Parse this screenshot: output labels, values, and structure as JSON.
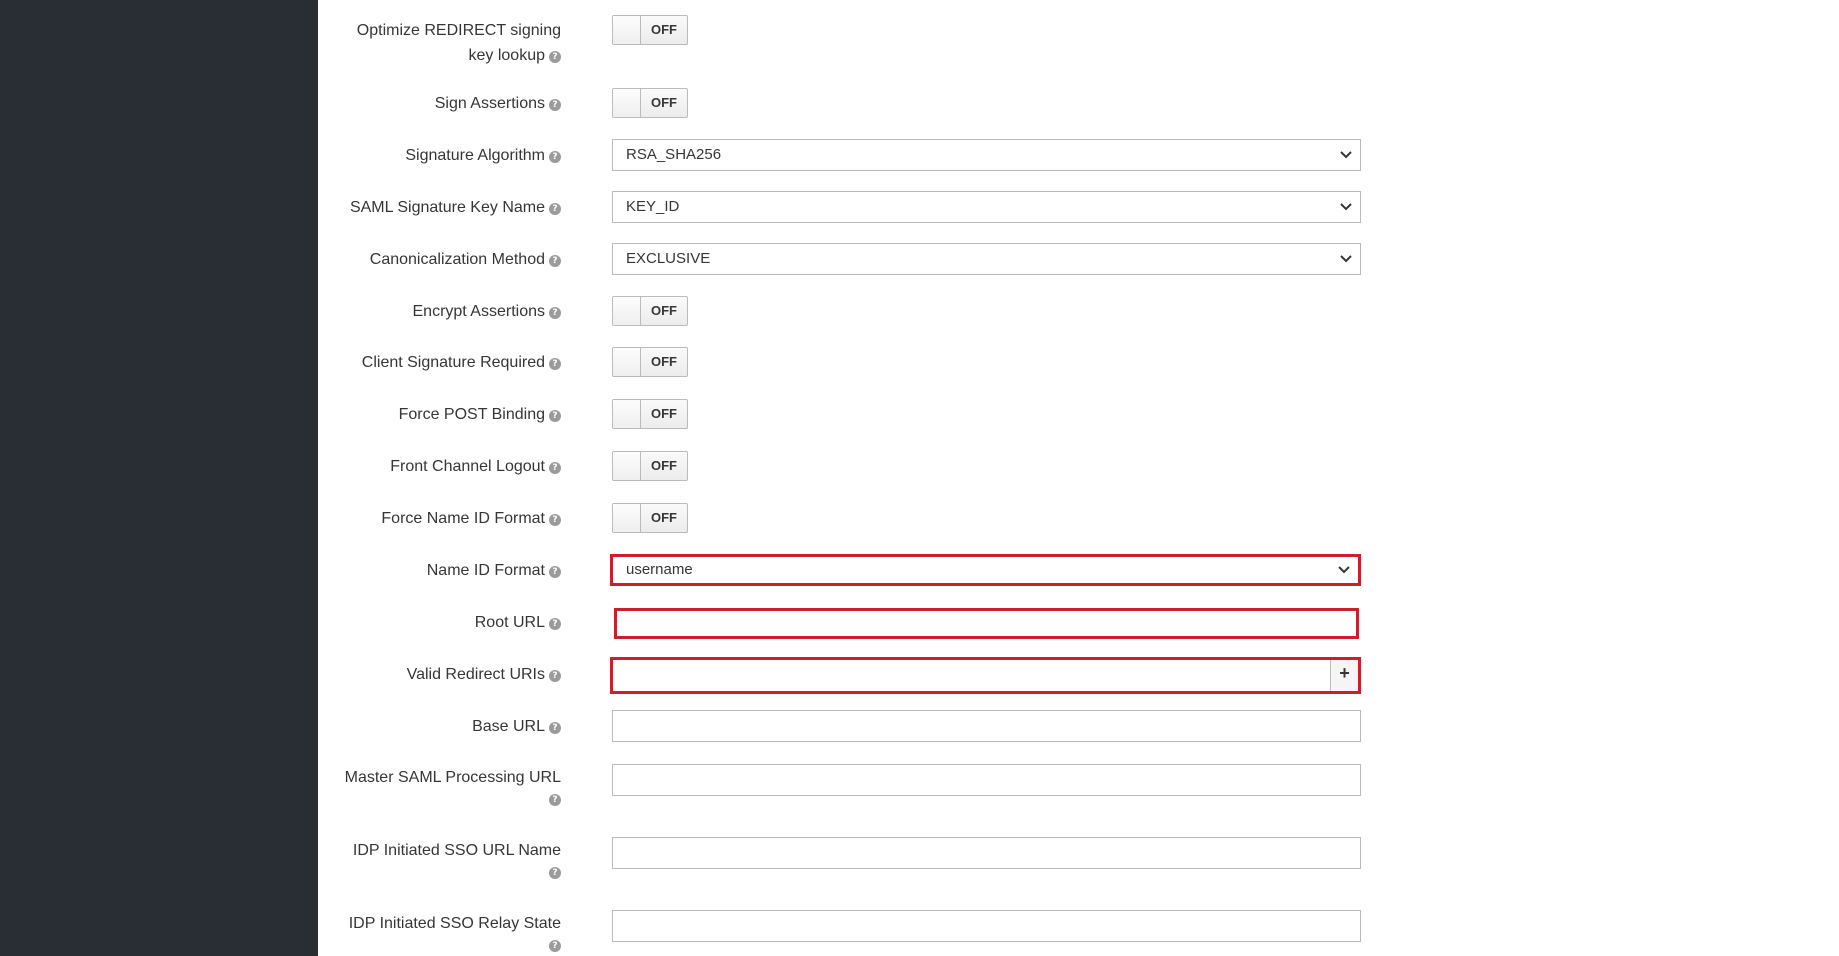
{
  "help_glyph": "?",
  "chevron": "chevron-down",
  "fields": {
    "optimize_redirect": {
      "label_line1": "Optimize REDIRECT signing",
      "label_line2": "key lookup",
      "state": "OFF"
    },
    "sign_assertions": {
      "label": "Sign Assertions",
      "state": "OFF"
    },
    "signature_algorithm": {
      "label": "Signature Algorithm",
      "value": "RSA_SHA256"
    },
    "saml_signature_key_name": {
      "label": "SAML Signature Key Name",
      "value": "KEY_ID"
    },
    "canonicalization_method": {
      "label": "Canonicalization Method",
      "value": "EXCLUSIVE"
    },
    "encrypt_assertions": {
      "label": "Encrypt Assertions",
      "state": "OFF"
    },
    "client_signature_required": {
      "label": "Client Signature Required",
      "state": "OFF"
    },
    "force_post_binding": {
      "label": "Force POST Binding",
      "state": "OFF"
    },
    "front_channel_logout": {
      "label": "Front Channel Logout",
      "state": "OFF"
    },
    "force_name_id_format": {
      "label": "Force Name ID Format",
      "state": "OFF"
    },
    "name_id_format": {
      "label": "Name ID Format",
      "value": "username",
      "highlighted": true
    },
    "root_url": {
      "label": "Root URL",
      "value": "",
      "highlighted": true
    },
    "valid_redirect_uris": {
      "label": "Valid Redirect URIs",
      "value": "",
      "add_label": "+",
      "highlighted": true
    },
    "base_url": {
      "label": "Base URL",
      "value": ""
    },
    "master_saml_processing_url": {
      "label": "Master SAML Processing URL",
      "value": ""
    },
    "idp_initiated_sso_url_name": {
      "label": "IDP Initiated SSO URL Name",
      "value": ""
    },
    "idp_initiated_sso_relay_state": {
      "label": "IDP Initiated SSO Relay State",
      "value": ""
    }
  },
  "colors": {
    "sidebar": "#292e34",
    "highlight": "#cc1f2b",
    "border": "#bbbbbb",
    "help_icon": "#9b9b9b"
  }
}
